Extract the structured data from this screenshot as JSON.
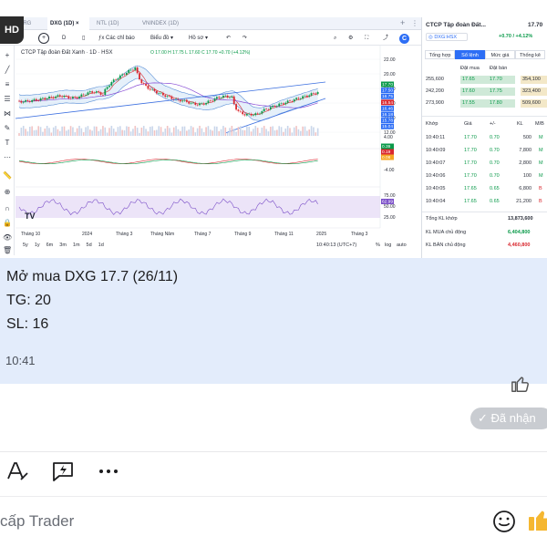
{
  "tabs": [
    {
      "label": "RRG",
      "active": false
    },
    {
      "label": "DXG (1D)",
      "active": true
    },
    {
      "label": "NTL (1D)",
      "active": false
    },
    {
      "label": "VNINDEX (1D)",
      "active": false
    }
  ],
  "hd_badge": "HD",
  "toolbar": {
    "symbol": "DXG",
    "interval": "D",
    "indicators": "Các chỉ báo",
    "chart_type": "Biểu đồ",
    "templates": "Hồ sơ"
  },
  "chart": {
    "legend_title": "CTCP Tập đoàn Đất Xanh · 1D · HSX",
    "legend_ohlc": "O 17.00 H 17.75 L 17.60 C 17.70 +0.70 (+4.12%)",
    "price_scale": [
      "22.00",
      "20.00",
      "18.00",
      "16.00",
      "14.00",
      "12.00"
    ],
    "price_labels": [
      {
        "text": "17.70",
        "color": "#0a9a4a"
      },
      {
        "text": "17.50",
        "color": "#2d6ef5"
      },
      {
        "text": "16.75",
        "color": "#2d6ef5"
      },
      {
        "text": "16.54",
        "color": "#d9282f"
      },
      {
        "text": "16.46",
        "color": "#2d6ef5"
      },
      {
        "text": "16.18",
        "color": "#2d6ef5"
      },
      {
        "text": "15.78",
        "color": "#2d6ef5"
      },
      {
        "text": "15.04",
        "color": "#2d6ef5"
      }
    ],
    "osc_scale": [
      "4.00",
      "0.00",
      "-4.00"
    ],
    "osc_labels": [
      "0.39",
      "0.19",
      "0.08"
    ],
    "rsi_scale": [
      "75.00",
      "50.00",
      "25.00"
    ],
    "rsi_label": "62.99",
    "x_axis": [
      "Tháng 10",
      "2024",
      "Tháng 3",
      "Tháng Năm",
      "Tháng 7",
      "Tháng 9",
      "Tháng 11",
      "2025",
      "Tháng 3"
    ],
    "ranges": [
      "5y",
      "1y",
      "6m",
      "3m",
      "1m",
      "5d",
      "1d"
    ],
    "clock": "10:40:13 (UTC+7)",
    "scale_modes": [
      "%",
      "log",
      "auto"
    ]
  },
  "panel": {
    "company": "CTCP Tập đoàn Đất...",
    "price": "17.70",
    "ticker": "DXG:HSX",
    "change": "+0.70 / +4.12%",
    "tabs": [
      "Tổng hợp",
      "Sổ lệnh",
      "Mức giá",
      "Thống kê"
    ],
    "ob_headers": [
      "Đặt mua",
      "Đặt bán"
    ],
    "orderbook": [
      {
        "bid_vol": "255,600",
        "bid": "17.65",
        "ask": "17.70",
        "ask_vol": "354,100"
      },
      {
        "bid_vol": "242,200",
        "bid": "17.60",
        "ask": "17.75",
        "ask_vol": "323,400"
      },
      {
        "bid_vol": "273,900",
        "bid": "17.55",
        "ask": "17.80",
        "ask_vol": "509,600"
      }
    ],
    "trade_headers": [
      "Khớp",
      "Giá",
      "+/-",
      "KL",
      "M/B"
    ],
    "trades": [
      {
        "time": "10:40:11",
        "price": "17.70",
        "chg": "0.70",
        "vol": "500",
        "side": "M"
      },
      {
        "time": "10:40:09",
        "price": "17.70",
        "chg": "0.70",
        "vol": "7,800",
        "side": "M"
      },
      {
        "time": "10:40:07",
        "price": "17.70",
        "chg": "0.70",
        "vol": "2,800",
        "side": "M"
      },
      {
        "time": "10:40:06",
        "price": "17.70",
        "chg": "0.70",
        "vol": "100",
        "side": "M"
      },
      {
        "time": "10:40:05",
        "price": "17.65",
        "chg": "0.65",
        "vol": "6,800",
        "side": "B"
      },
      {
        "time": "10:40:04",
        "price": "17.65",
        "chg": "0.65",
        "vol": "21,200",
        "side": "B"
      }
    ],
    "total_label": "Tổng KL khớp",
    "total_value": "13,873,600",
    "buy_label": "KL MUA chủ động",
    "buy_value": "6,404,800",
    "sell_label": "KL BÁN chủ động",
    "sell_value": "4,460,800"
  },
  "message": {
    "line1": "Mở mua DXG 17.7 (26/11)",
    "line2": "TG: 20",
    "line3": "SL: 16",
    "time": "10:41"
  },
  "received_label": "Đã nhận",
  "composer": {
    "placeholder": "cấp Trader"
  },
  "colors": {
    "up": "#0a9a4a",
    "down": "#d9282f",
    "accent": "#2d6ef5",
    "message_bg": "#e3ecfb"
  }
}
